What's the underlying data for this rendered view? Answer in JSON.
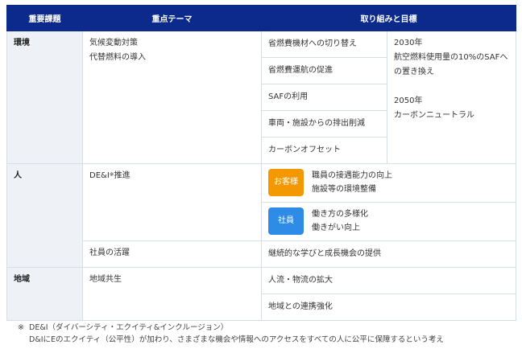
{
  "headers": {
    "issue": "重要課題",
    "theme": "重点テーマ",
    "actions": "取り組みと目標"
  },
  "environment": {
    "issue": "環境",
    "theme_lines": [
      "気候変動対策",
      "代替燃料の導入"
    ],
    "actions": [
      "省燃費機材への切り替え",
      "省燃費運航の促進",
      "SAFの利用",
      "車両・施設からの排出削減",
      "カーボンオフセット"
    ],
    "goals": {
      "g1_year": "2030年",
      "g1_text_a": "航空燃料使用量の10%のSAFへ",
      "g1_text_b": "の置き換え",
      "g2_year": "2050年",
      "g2_text": "カーボンニュートラル"
    }
  },
  "people": {
    "issue": "人",
    "theme1_prefix": "DE&I",
    "theme1_sup": "※",
    "theme1_suffix": "推進",
    "customer": {
      "tag": "お客様",
      "lines": [
        "職員の接遇能力の向上",
        "施設等の環境整備"
      ],
      "color": "#f39800"
    },
    "employee": {
      "tag": "社員",
      "lines": [
        "働き方の多様化",
        "働きがい向上"
      ],
      "color": "#2e8be6"
    },
    "theme2": "社員の活躍",
    "theme2_action": "継続的な学びと成長機会の提供"
  },
  "community": {
    "issue": "地域",
    "theme": "地域共生",
    "actions": [
      "人流・物流の拡大",
      "地域との連携強化"
    ]
  },
  "footnote": {
    "mark": "※",
    "line1": "DE&I（ダイバーシティ・エクイティ&インクルージョン）",
    "line2": "D&IにEのエクイティ（公平性）が加わり、さまざまな機会や情報へのアクセスをすべての人に公平に保障するという考え"
  },
  "colors": {
    "header_bg": "#0b2a8c",
    "issue_bg": "#eef1f5",
    "border": "#d5dde8"
  }
}
